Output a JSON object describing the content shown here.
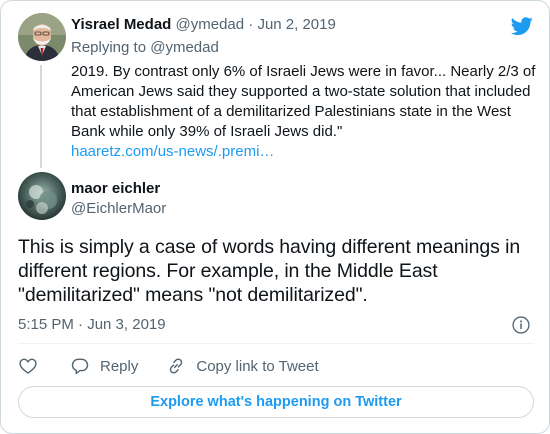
{
  "parent_tweet": {
    "display_name": "Yisrael Medad",
    "handle": "@ymedad",
    "separator": "·",
    "date": "Jun 2, 2019",
    "replying_to_prefix": "Replying to",
    "replying_to_handle": "@ymedad",
    "text": "2019. By contrast only 6% of Israeli Jews were in favor... Nearly 2/3 of American Jews said they supported a two-state solution that included that establishment of a demilitarized Palestinians state in the West Bank while only 39% of Israeli Jews did.\"",
    "link": "haaretz.com/us-news/.premi…"
  },
  "main_tweet": {
    "display_name": "maor eichler",
    "handle": "@EichlerMaor",
    "text": "This is simply a case of words having different meanings in different regions. For example, in the Middle East \"demilitarized\" means \"not demilitarized\".",
    "timestamp": "5:15 PM · Jun 3, 2019"
  },
  "actions": {
    "reply_label": "Reply",
    "copy_link_label": "Copy link to Tweet"
  },
  "footer": {
    "explore_label": "Explore what's happening on Twitter"
  },
  "colors": {
    "accent": "#1d9bf0",
    "secondary_text": "#536471",
    "border": "#cfd9de"
  },
  "icons": {
    "logo": "twitter-bird-icon",
    "info": "info-icon",
    "like": "heart-icon",
    "reply": "speech-bubble-icon",
    "copy_link": "link-icon"
  }
}
